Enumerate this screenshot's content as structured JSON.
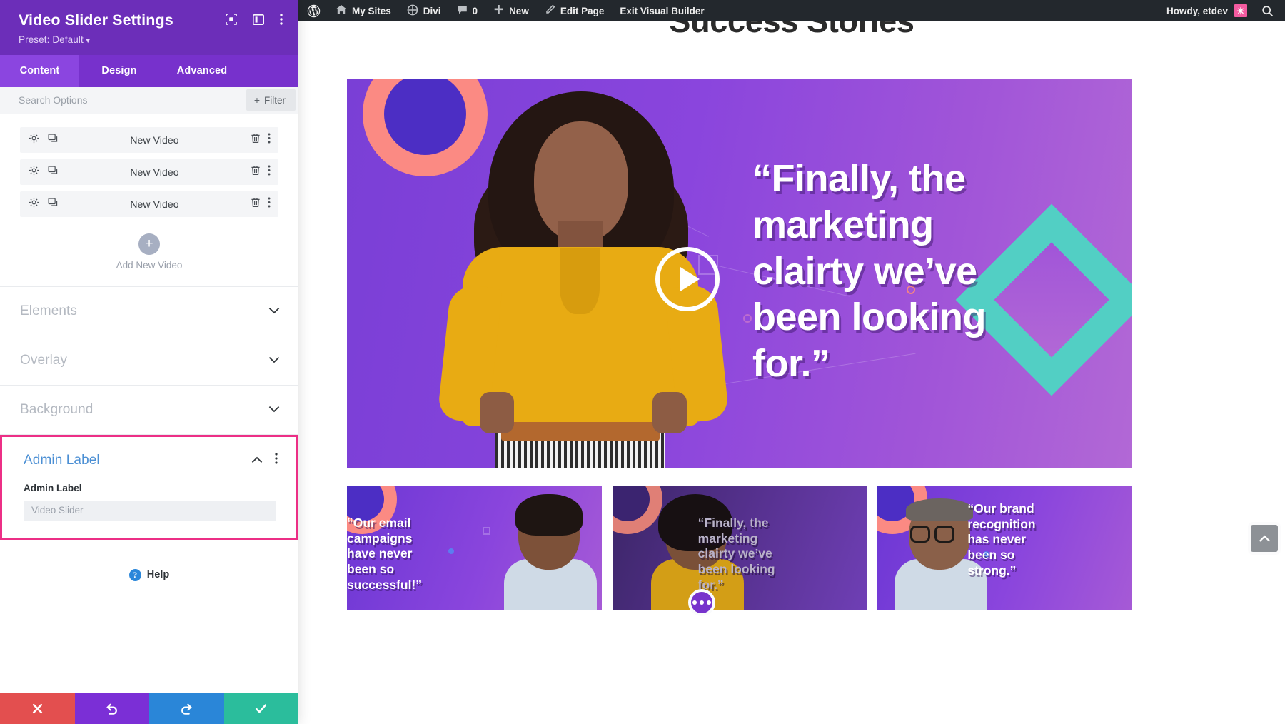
{
  "panel": {
    "title": "Video Slider Settings",
    "preset": "Preset: Default",
    "head_icons": [
      "focus-target-icon",
      "layout-split-icon",
      "vertical-dots-icon"
    ],
    "tabs": [
      {
        "label": "Content",
        "active": true
      },
      {
        "label": "Design",
        "active": false
      },
      {
        "label": "Advanced",
        "active": false
      }
    ],
    "search": {
      "placeholder": "Search Options",
      "value": "",
      "filter_label": "Filter",
      "filter_plus": "+"
    },
    "videos": [
      {
        "name": "New Video"
      },
      {
        "name": "New Video"
      },
      {
        "name": "New Video"
      }
    ],
    "add_new": {
      "plus": "+",
      "label": "Add New Video"
    },
    "sections": [
      {
        "label": "Elements",
        "expanded": false
      },
      {
        "label": "Overlay",
        "expanded": false
      },
      {
        "label": "Background",
        "expanded": false
      }
    ],
    "admin_label_section": {
      "header": "Admin Label",
      "field_label": "Admin Label",
      "field_placeholder": "Video Slider",
      "field_value": "",
      "highlight_color": "#ec2f86",
      "header_color": "#4b8fd4"
    },
    "help": {
      "label": "Help",
      "glyph": "?"
    },
    "actions": [
      {
        "name": "cancel",
        "glyph": "✕",
        "color": "#e34f4f"
      },
      {
        "name": "undo",
        "glyph": "↺",
        "color": "#7b2fd6"
      },
      {
        "name": "redo",
        "glyph": "↻",
        "color": "#2a86d8"
      },
      {
        "name": "save",
        "glyph": "✓",
        "color": "#2bbd9c"
      }
    ]
  },
  "adminbar": {
    "items": [
      {
        "label": "My Sites",
        "icon": "sites-icon"
      },
      {
        "label": "Divi",
        "icon": "divi-icon"
      },
      {
        "label": "0",
        "icon": "comment-icon"
      },
      {
        "label": "New",
        "icon": "plus-icon"
      },
      {
        "label": "Edit Page",
        "icon": "pencil-icon"
      },
      {
        "label": "Exit Visual Builder",
        "icon": ""
      }
    ],
    "howdy": "Howdy, etdev",
    "search_icon": "search-icon",
    "wp_logo": "wordpress-logo-icon"
  },
  "page": {
    "heading": "Success Stories",
    "hero": {
      "quote": "“Finally, the marketing clairty we’ve been looking for.”",
      "play_label": "play-button"
    },
    "thumbnails": [
      {
        "quote": "“Our email campaigns have never been so successful!”"
      },
      {
        "quote": "“Finally, the marketing clairty we’ve been looking for.”"
      },
      {
        "quote": "“Our brand recognition has never been so strong.”"
      }
    ],
    "fab": "more-options-button",
    "to_top": "scroll-to-top-button"
  }
}
